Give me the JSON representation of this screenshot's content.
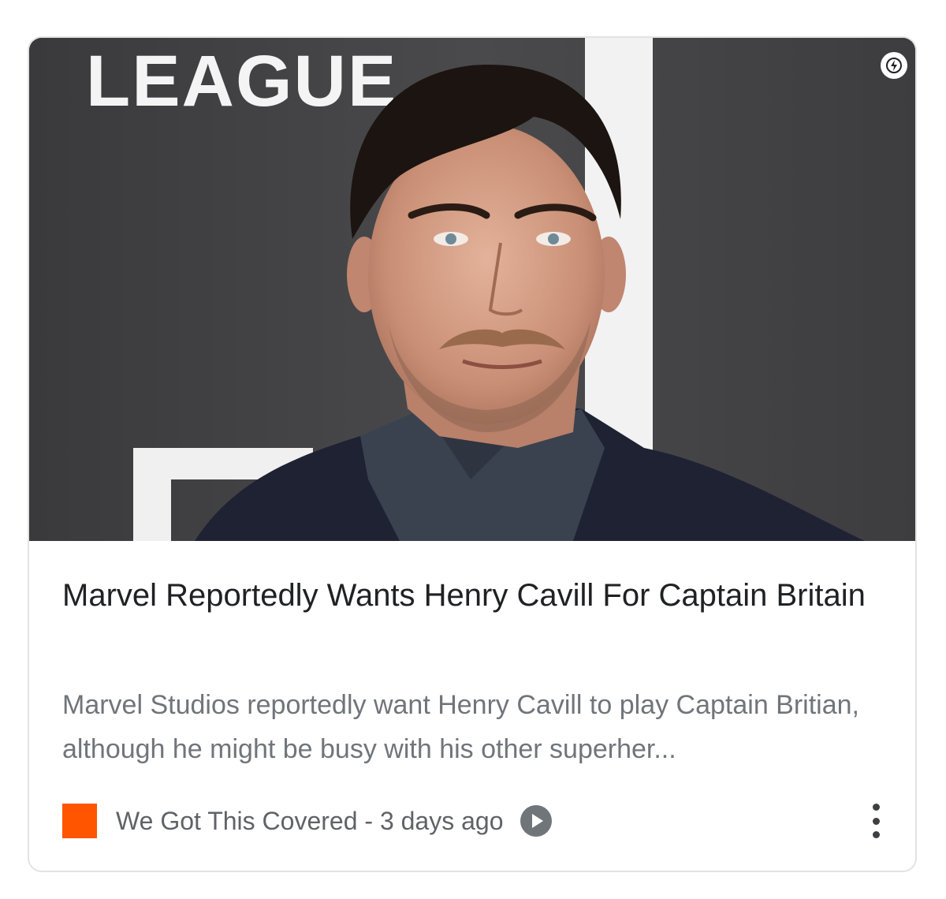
{
  "article": {
    "image_text": "LEAGUE",
    "headline": "Marvel Reportedly Wants Henry Cavill For Captain Britain",
    "snippet": "Marvel Studios reportedly want Henry Cavill to play Captain Britian, although he might be busy with his other superher...",
    "source": "We Got This Covered",
    "separator": " - ",
    "age": "3 days ago"
  },
  "icons": {
    "amp": "lightning-bolt-icon",
    "source_logo": "source-logo",
    "play": "play-icon",
    "more": "more-vert-icon"
  },
  "colors": {
    "source_logo": "#ff5500",
    "headline": "#202124",
    "snippet": "#70757a",
    "meta": "#5f6368"
  }
}
